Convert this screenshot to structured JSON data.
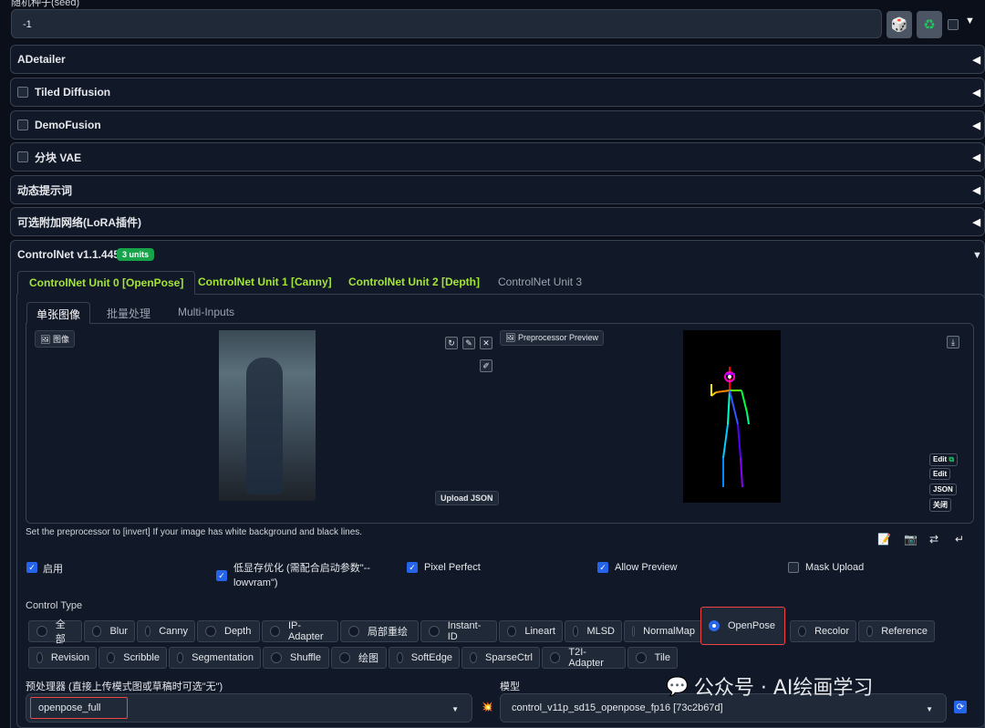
{
  "seed": {
    "label": "随机种子(seed)",
    "value": "-1"
  },
  "accordions": [
    {
      "label": "ADetailer"
    },
    {
      "label": "Tiled Diffusion"
    },
    {
      "label": "DemoFusion"
    },
    {
      "label": "分块 VAE"
    },
    {
      "label": "动态提示词"
    },
    {
      "label": "可选附加网络(LoRA插件)"
    }
  ],
  "controlnet": {
    "title": "ControlNet v1.1.445",
    "badge": "3 units",
    "units": [
      "ControlNet Unit 0 [OpenPose]",
      "ControlNet Unit 1 [Canny]",
      "ControlNet Unit 2 [Depth]",
      "ControlNet Unit 3"
    ],
    "subtabs": [
      "单张图像",
      "批量处理",
      "Multi-Inputs"
    ],
    "image_tag": "图像",
    "preview_tag": "Preprocessor Preview",
    "upload_json": "Upload JSON",
    "edit_buttons": [
      "Edit",
      "Edit",
      "JSON",
      "关闭"
    ],
    "hint": "Set the preprocessor to [invert] If your image has white background and black lines.",
    "options": {
      "enable": "启用",
      "lowvram": "低显存优化 (需配合启动参数\"--lowvram\")",
      "pixel_perfect": "Pixel Perfect",
      "allow_preview": "Allow Preview",
      "mask_upload": "Mask Upload"
    },
    "control_type_label": "Control Type",
    "control_types_row1": [
      "全部",
      "Blur",
      "Canny",
      "Depth",
      "IP-Adapter",
      "局部重绘",
      "Instant-ID",
      "Lineart",
      "MLSD",
      "NormalMap",
      "OpenPose",
      "Recolor",
      "Reference"
    ],
    "control_types_row2": [
      "Revision",
      "Scribble",
      "Segmentation",
      "Shuffle",
      "绘图",
      "SoftEdge",
      "SparseCtrl",
      "T2I-Adapter",
      "Tile"
    ],
    "selected_type": "OpenPose",
    "preprocessor_label": "预处理器 (直接上传模式图或草稿时可选\"无\")",
    "preprocessor_value": "openpose_full",
    "model_label": "模型",
    "model_value": "control_v11p_sd15_openpose_fp16 [73c2b67d]"
  },
  "watermark": "公众号 · AI绘画学习",
  "colors": {
    "accent": "#a3e635",
    "primary": "#2563eb",
    "highlight": "#ef4444",
    "badge": "#16a34a"
  }
}
